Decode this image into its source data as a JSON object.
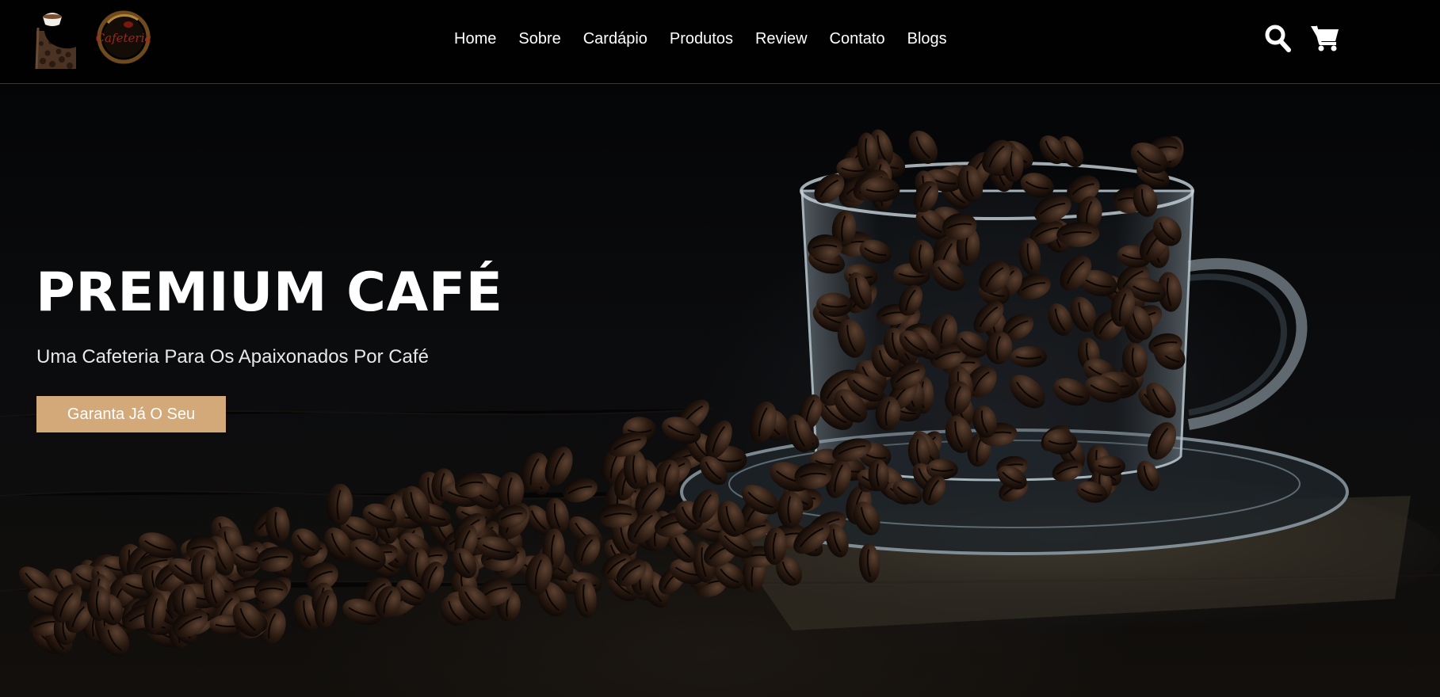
{
  "brand": {
    "logo_icon": "coffee-cup-pour-icon",
    "logo_badge_text": "Cafeteria"
  },
  "nav": {
    "items": [
      {
        "label": "Home"
      },
      {
        "label": "Sobre"
      },
      {
        "label": "Cardápio"
      },
      {
        "label": "Produtos"
      },
      {
        "label": "Review"
      },
      {
        "label": "Contato"
      },
      {
        "label": "Blogs"
      }
    ]
  },
  "actions": {
    "search_icon": "search-icon",
    "cart_icon": "shopping-cart-icon"
  },
  "hero": {
    "title": "PREMIUM CAFÉ",
    "subtitle": "Uma Cafeteria Para Os Apaixonados Por Café",
    "cta_label": "Garanta Já O Seu",
    "image": "coffee-beans-glass-cup"
  },
  "colors": {
    "header_bg": "#010101",
    "accent": "#d3a97a",
    "text": "#ffffff"
  }
}
